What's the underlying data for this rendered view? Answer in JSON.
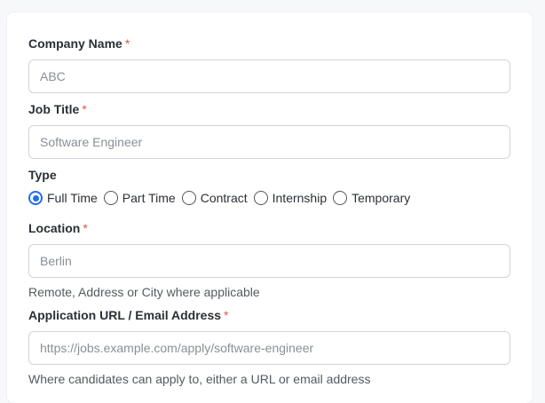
{
  "form": {
    "company": {
      "label": "Company Name",
      "required_mark": "*",
      "placeholder": "ABC",
      "value": ""
    },
    "job_title": {
      "label": "Job Title",
      "required_mark": "*",
      "placeholder": "Software Engineer",
      "value": ""
    },
    "type": {
      "label": "Type",
      "selected": "Full Time",
      "options": [
        {
          "label": "Full Time",
          "checked": true
        },
        {
          "label": "Part Time",
          "checked": false
        },
        {
          "label": "Contract",
          "checked": false
        },
        {
          "label": "Internship",
          "checked": false
        },
        {
          "label": "Temporary",
          "checked": false
        }
      ]
    },
    "location": {
      "label": "Location",
      "required_mark": "*",
      "placeholder": "Berlin",
      "value": "",
      "help": "Remote, Address or City where applicable"
    },
    "application": {
      "label": "Application URL / Email Address",
      "required_mark": "*",
      "placeholder": "https://jobs.example.com/apply/software-engineer",
      "value": "",
      "help": "Where candidates can apply to, either a URL or email address"
    }
  },
  "colors": {
    "accent": "#1f6feb",
    "required": "#e5534b",
    "background": "#f7f8fa",
    "card": "#ffffff"
  }
}
